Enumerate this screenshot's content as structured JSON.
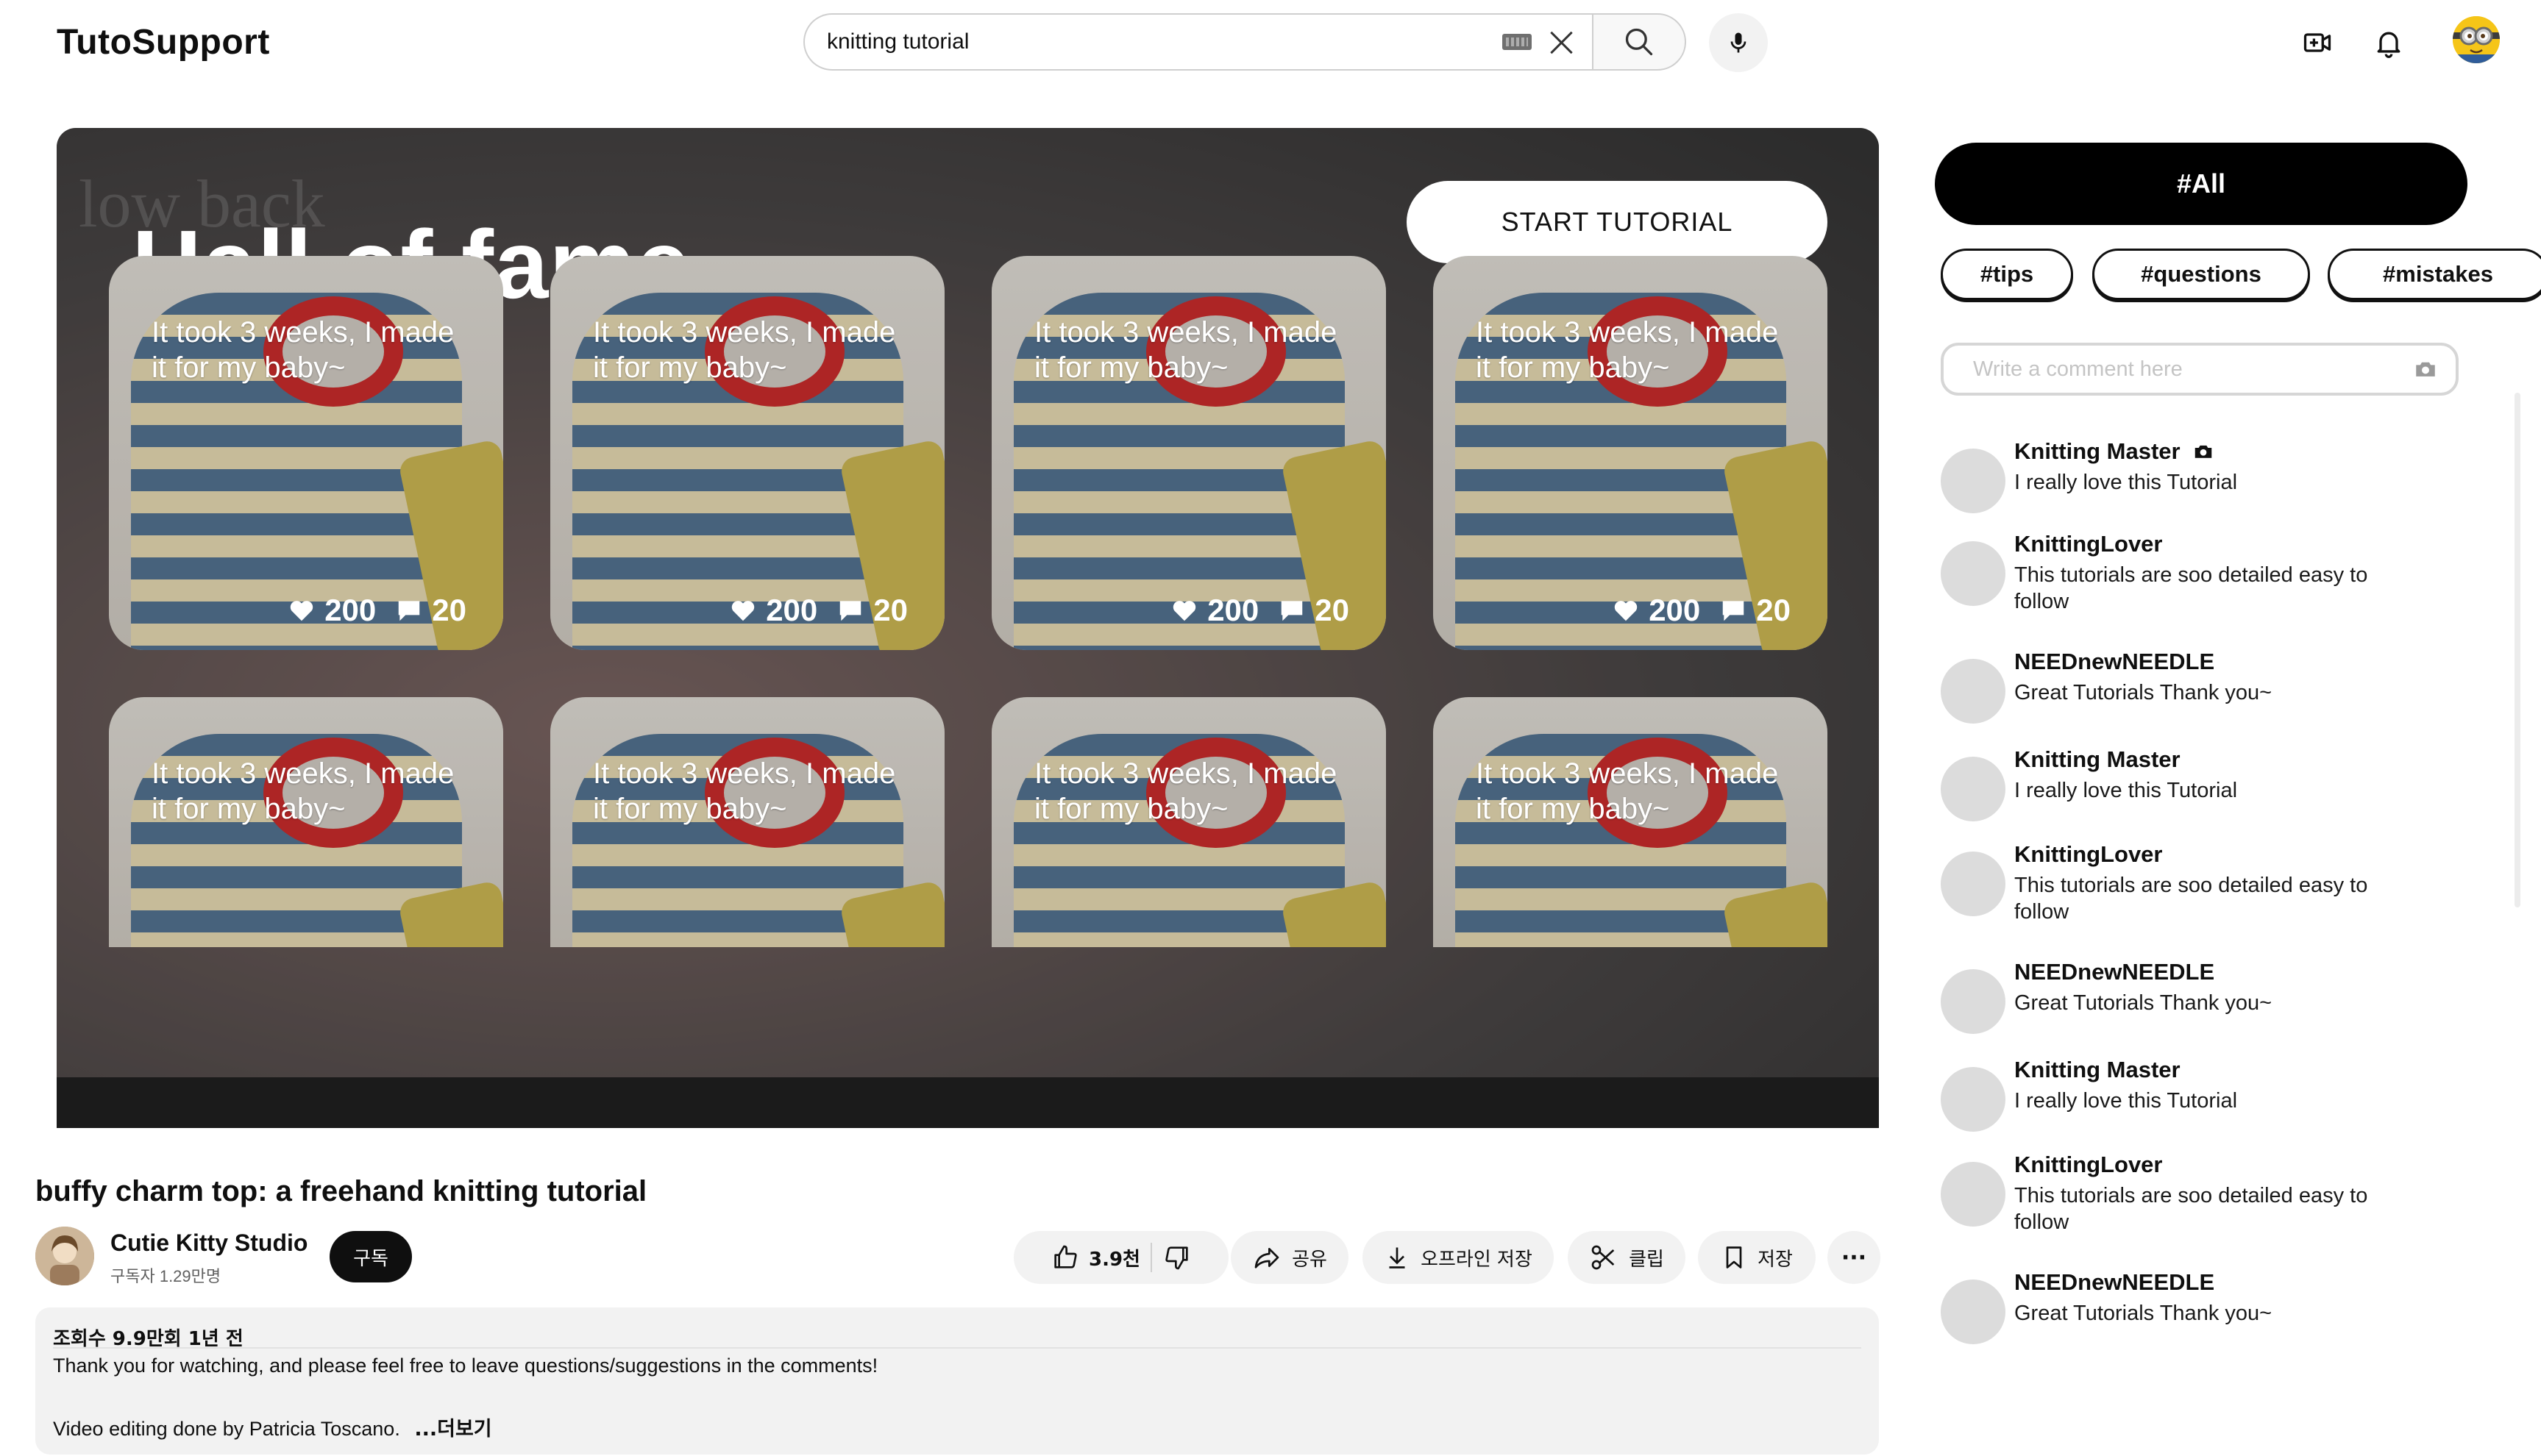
{
  "header": {
    "logo": "TutoSupport",
    "search_value": "knitting tutorial",
    "icons": [
      "keyboard-icon",
      "clear-icon",
      "search-icon",
      "mic-icon",
      "create-video-icon",
      "bell-icon",
      "avatar"
    ]
  },
  "player": {
    "ghost_text": "low back",
    "title": "Hall of fame",
    "start_button": "START TUTORIAL",
    "cards": [
      {
        "text": "It took 3 weeks, I made it for my baby~",
        "likes": "200",
        "comments": "20"
      },
      {
        "text": "It took 3 weeks, I made it for my baby~",
        "likes": "200",
        "comments": "20"
      },
      {
        "text": "It took 3 weeks, I made it for my baby~",
        "likes": "200",
        "comments": "20"
      },
      {
        "text": "It took 3 weeks, I made it for my baby~",
        "likes": "200",
        "comments": "20"
      },
      {
        "text": "It took 3 weeks, I made it for my baby~"
      },
      {
        "text": "It took 3 weeks, I made it for my baby~"
      },
      {
        "text": "It took 3 weeks, I made it for my baby~"
      },
      {
        "text": "It took 3 weeks, I made it for my baby~"
      }
    ]
  },
  "video": {
    "title": "buffy charm top: a freehand knitting tutorial",
    "channel_name": "Cutie Kitty Studio",
    "subscribers": "구독자 1.29만명",
    "subscribe_label": "구독",
    "actions": {
      "likes": "3.9천",
      "share": "공유",
      "download": "오프라인 저장",
      "clip": "클립",
      "save": "저장",
      "more": "···"
    },
    "description": {
      "meta": "조회수 9.9만회  1년 전",
      "line1": "Thank you for watching, and please feel free to leave questions/suggestions in the comments!",
      "line2": "Video editing done by Patricia Toscano.",
      "more": "...더보기"
    }
  },
  "panel": {
    "filter_all": "#All",
    "chips": [
      "#tips",
      "#questions",
      "#mistakes"
    ],
    "comment_placeholder": "Write a comment here",
    "comments": [
      {
        "name": "Knitting Master",
        "text": "I really love this Tutorial"
      },
      {
        "name": "KnittingLover",
        "text": "This tutorials are soo detailed easy to follow"
      },
      {
        "name": "NEEDnewNEEDLE",
        "text": "Great Tutorials Thank you~"
      },
      {
        "name": "Knitting Master",
        "text": "I really love this Tutorial"
      },
      {
        "name": "KnittingLover",
        "text": "This tutorials are soo detailed easy to follow"
      },
      {
        "name": "NEEDnewNEEDLE",
        "text": "Great Tutorials Thank you~"
      },
      {
        "name": "Knitting Master",
        "text": "I really love this Tutorial"
      },
      {
        "name": "KnittingLover",
        "text": "This tutorials are soo detailed easy to follow"
      },
      {
        "name": "NEEDnewNEEDLE",
        "text": "Great Tutorials Thank you~"
      }
    ]
  },
  "colors": {
    "accent_black": "#000000",
    "chip_bg": "#f2f2f2",
    "collar_red": "#c62020"
  }
}
